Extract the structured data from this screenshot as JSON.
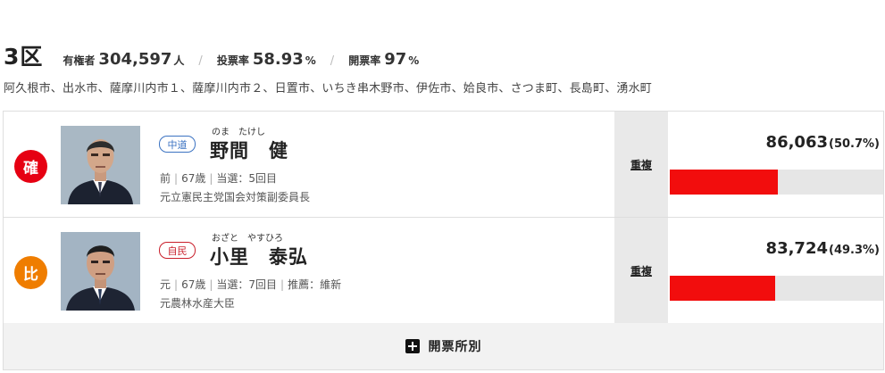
{
  "district": {
    "name": "3区",
    "electorate_label": "有権者",
    "electorate_value": "304,597",
    "electorate_unit": "人",
    "turnout_label": "投票率",
    "turnout_value": "58.93",
    "turnout_unit": "%",
    "counted_label": "開票率",
    "counted_value": "97",
    "counted_unit": "%",
    "separator": "/",
    "areas": "阿久根市、出水市、薩摩川内市１、薩摩川内市２、日置市、いちき串木野市、伊佐市、姶良市、さつま町、長島町、湧水町"
  },
  "candidates": [
    {
      "status": "確",
      "party": "中道",
      "kana": "のま　たけし",
      "name": "野間　健",
      "incumbency": "前",
      "age": "67歳",
      "terms": "当選：5回目",
      "recommend": "",
      "career": "元立憲民主党国会対策副委員長",
      "duplicate": "重複",
      "votes": "86,063",
      "percent": "(50.7%)",
      "share": 50.7,
      "bar_color": "#f20d0d"
    },
    {
      "status": "比",
      "party": "自民",
      "kana": "おざと　やすひろ",
      "name": "小里　泰弘",
      "incumbency": "元",
      "age": "67歳",
      "terms": "当選：7回目",
      "recommend": "推薦：維新",
      "career": "元農林水産大臣",
      "duplicate": "重複",
      "votes": "83,724",
      "percent": "(49.3%)",
      "share": 49.3,
      "bar_color": "#f20d0d"
    }
  ],
  "footer": {
    "label": "開票所別",
    "icon": "plus-icon"
  },
  "colors": {
    "win_badge": "#e60012",
    "proportional_badge": "#ef7d00",
    "party_chudo": "#3c73c2",
    "party_jimin": "#c91f2b",
    "bar_fill": "#f20d0d",
    "bar_track": "#e6e6e6"
  }
}
